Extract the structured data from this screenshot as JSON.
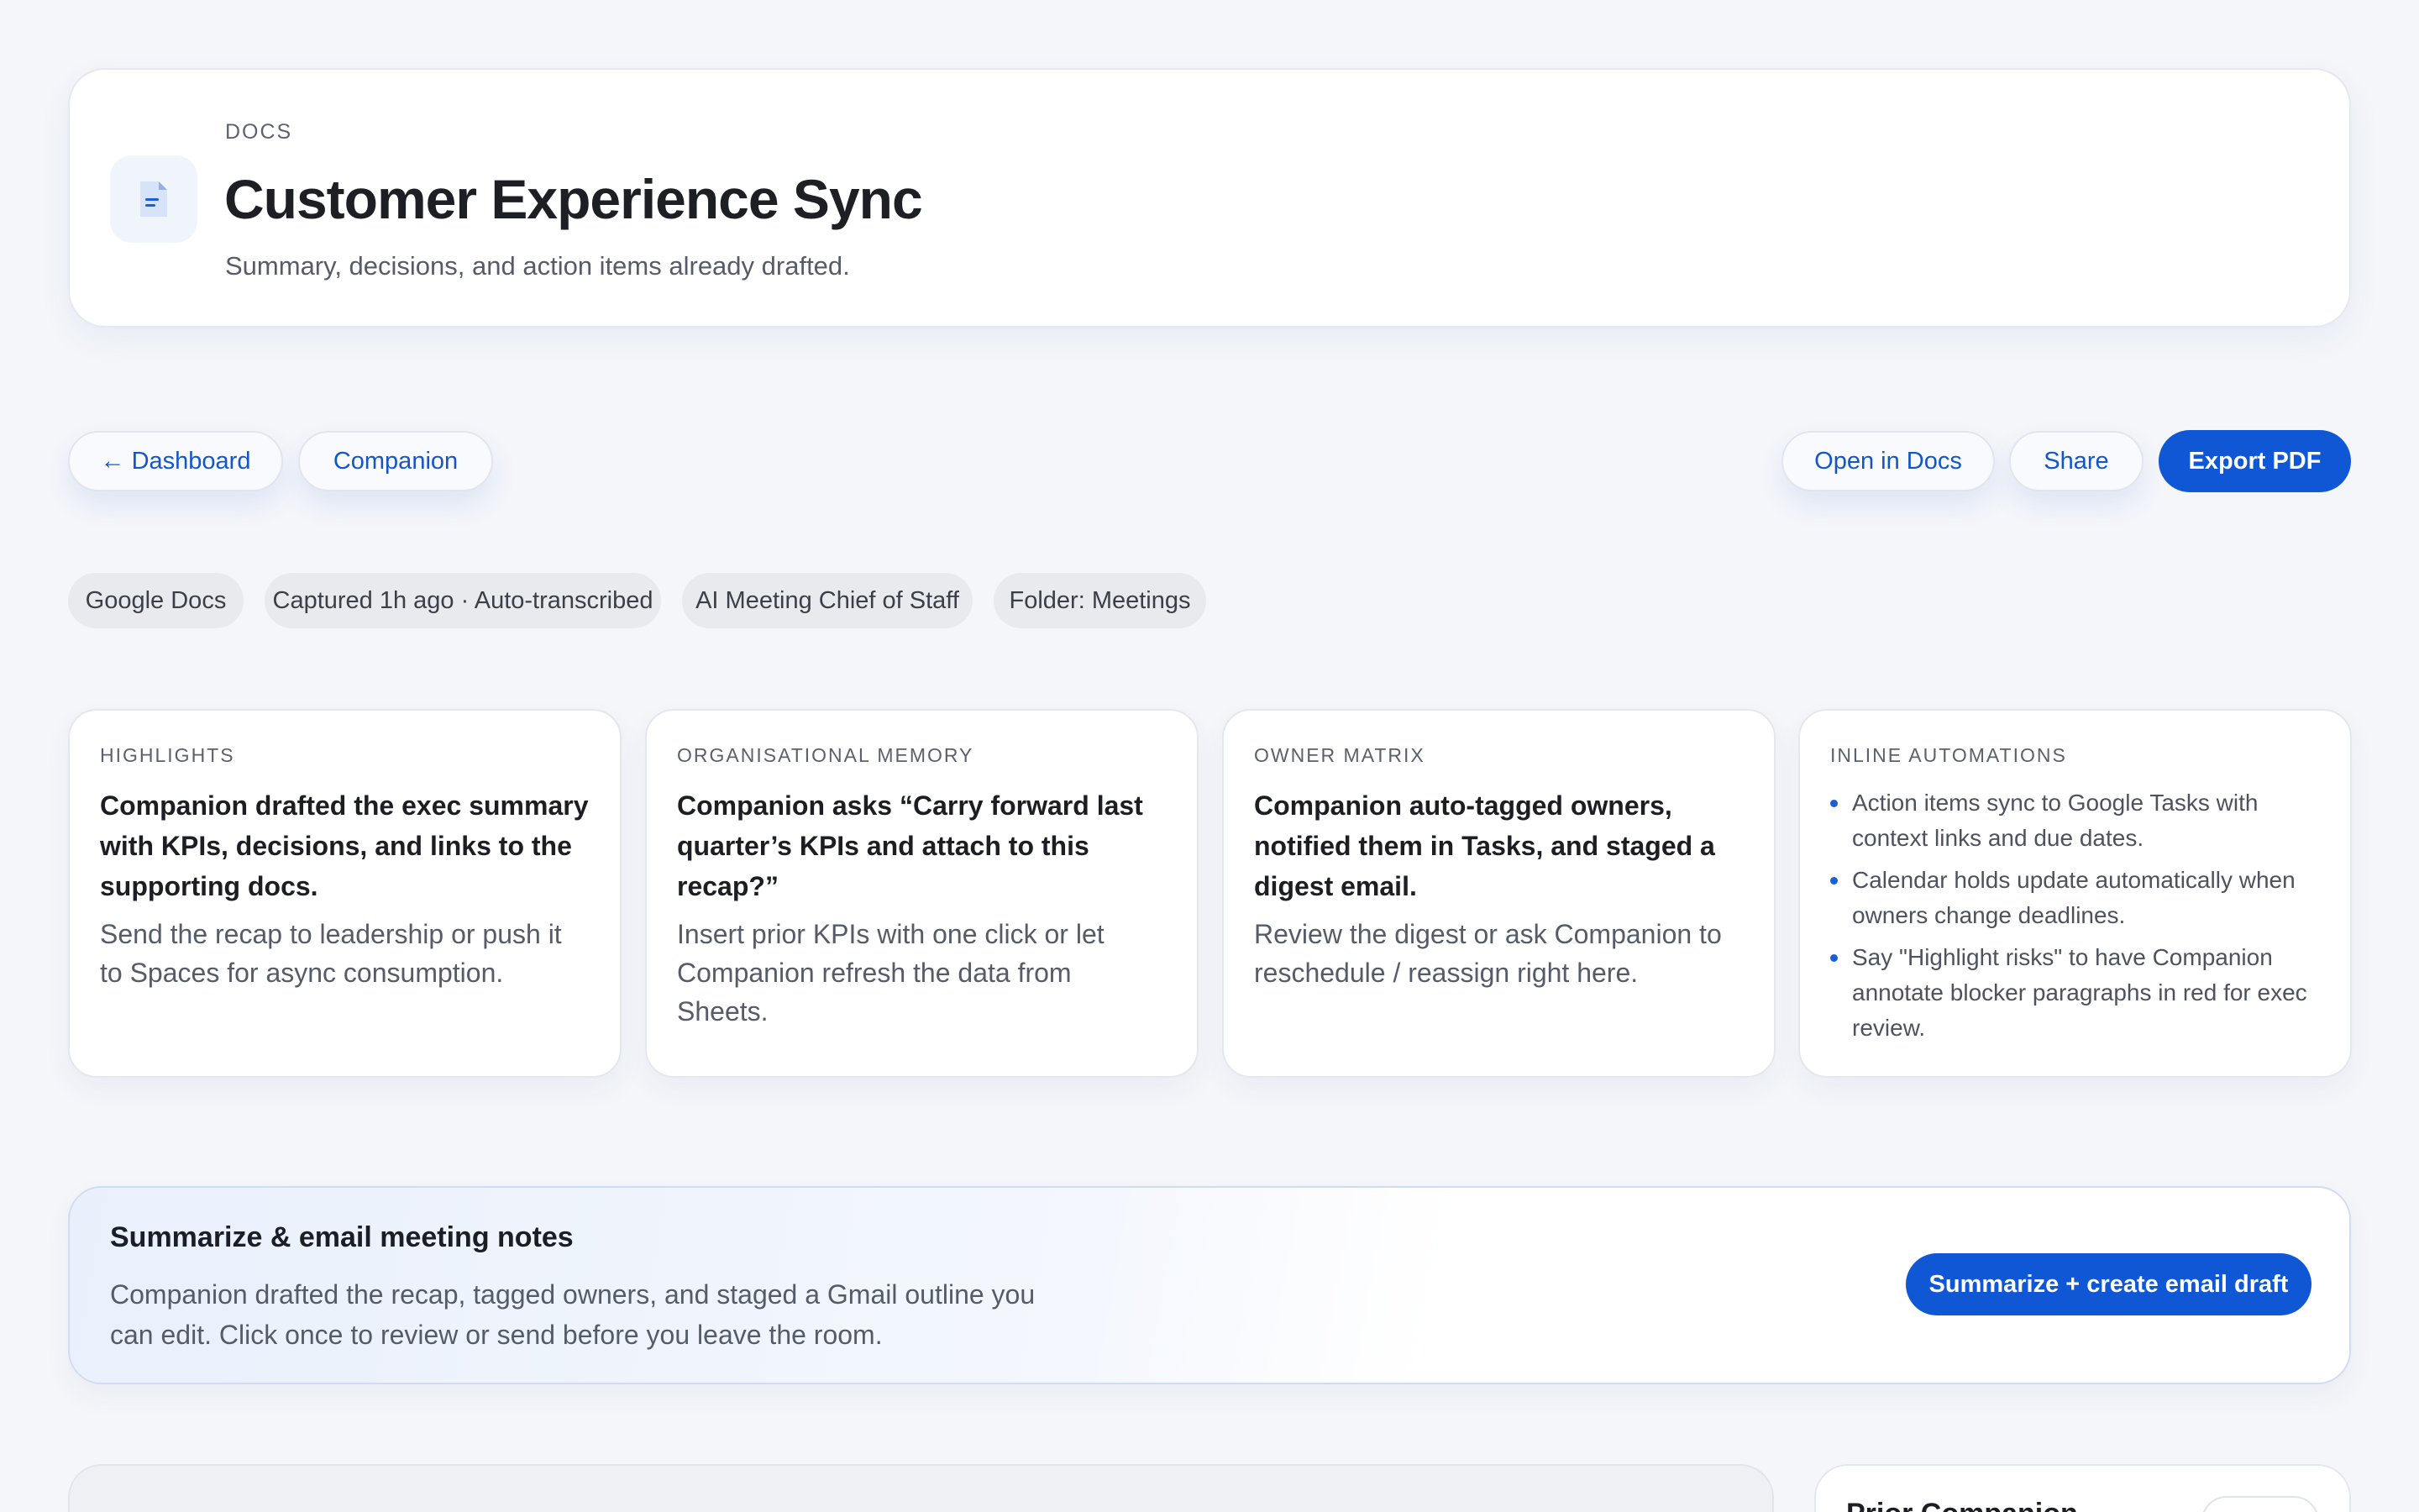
{
  "header": {
    "eyebrow": "DOCS",
    "title": "Customer Experience Sync",
    "subtitle": "Summary, decisions, and action items already drafted.",
    "icon": "doc-icon"
  },
  "toolbar": {
    "back_label": "← Dashboard",
    "companion_label": "Companion",
    "open_label": "Open in Docs",
    "share_label": "Share",
    "export_label": "Export PDF"
  },
  "tags": [
    "Google Docs",
    "Captured 1h ago · Auto-transcribed",
    "AI Meeting Chief of Staff",
    "Folder: Meetings"
  ],
  "cards": [
    {
      "label": "HIGHLIGHTS",
      "headline": "Companion drafted the exec summary with KPIs, decisions, and links to the supporting docs.",
      "body": "Send the recap to leadership or push it to Spaces for async consumption."
    },
    {
      "label": "ORGANISATIONAL MEMORY",
      "headline": "Companion asks “Carry forward last quarter’s KPIs and attach to this recap?”",
      "body": "Insert prior KPIs with one click or let Companion refresh the data from Sheets."
    },
    {
      "label": "OWNER MATRIX",
      "headline": "Companion auto-tagged owners, notified them in Tasks, and staged a digest email.",
      "body": "Review the digest or ask Companion to reschedule / reassign right here."
    },
    {
      "label": "INLINE AUTOMATIONS",
      "bullets": [
        "Action items sync to Google Tasks with context links and due dates.",
        "Calendar holds update automatically when owners change deadlines.",
        "Say \"Highlight risks\" to have Companion annotate blocker paragraphs in red for exec review."
      ]
    }
  ],
  "banner": {
    "title": "Summarize & email meeting notes",
    "body": "Companion drafted the recap, tagged owners, and staged a Gmail outline you can edit. Click once to review or send before you leave the room.",
    "cta_label": "Summarize + create email draft"
  },
  "bottom_right": {
    "title": "Prior Companion..."
  },
  "colors": {
    "accent": "#0f57d4",
    "background": "#f4f6fa"
  }
}
